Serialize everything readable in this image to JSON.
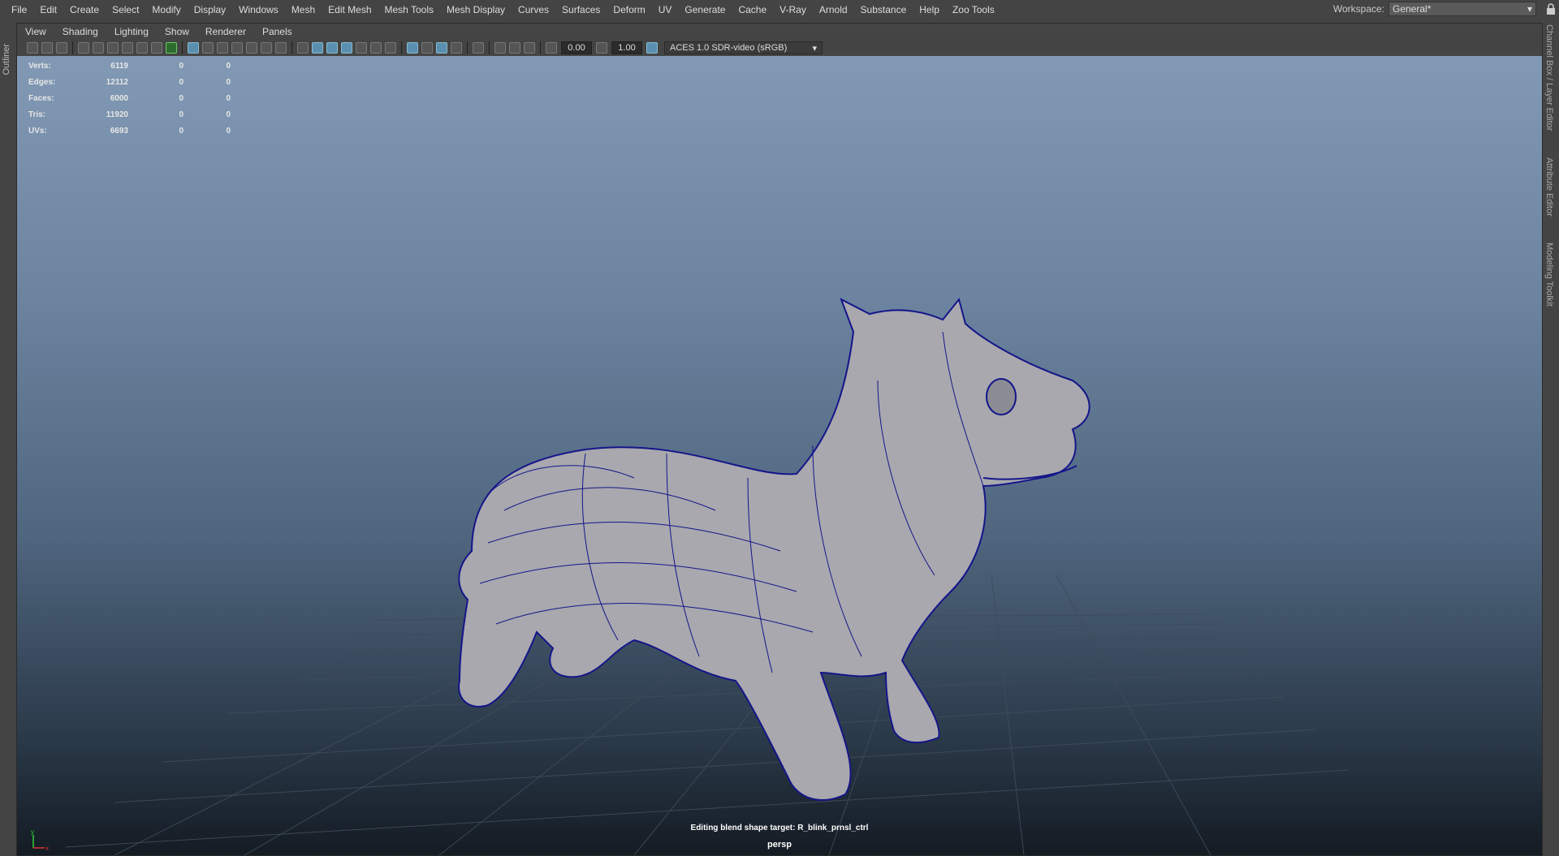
{
  "menubar": {
    "items": [
      "File",
      "Edit",
      "Create",
      "Select",
      "Modify",
      "Display",
      "Windows",
      "Mesh",
      "Edit Mesh",
      "Mesh Tools",
      "Mesh Display",
      "Curves",
      "Surfaces",
      "Deform",
      "UV",
      "Generate",
      "Cache",
      "V-Ray",
      "Arnold",
      "Substance",
      "Help",
      "Zoo Tools"
    ],
    "workspace_label": "Workspace:",
    "workspace_value": "General*"
  },
  "left_tabs": {
    "outliner": "Outliner"
  },
  "right_tabs": [
    "Channel Box / Layer Editor",
    "Attribute Editor",
    "Modeling Toolkit"
  ],
  "panel": {
    "menu": [
      "View",
      "Shading",
      "Lighting",
      "Show",
      "Renderer",
      "Panels"
    ],
    "toolbar": {
      "exposure": "0.00",
      "gamma": "1.00",
      "color_space": "ACES 1.0 SDR-video (sRGB)"
    }
  },
  "hud": {
    "rows": [
      {
        "label": "Verts:",
        "a": "6119",
        "b": "0",
        "c": "0"
      },
      {
        "label": "Edges:",
        "a": "12112",
        "b": "0",
        "c": "0"
      },
      {
        "label": "Faces:",
        "a": "6000",
        "b": "0",
        "c": "0"
      },
      {
        "label": "Tris:",
        "a": "11920",
        "b": "0",
        "c": "0"
      },
      {
        "label": "UVs:",
        "a": "6693",
        "b": "0",
        "c": "0"
      }
    ]
  },
  "viewport": {
    "message": "Editing blend shape target: R_blink_prnsl_ctrl",
    "camera": "persp",
    "axis_y": "y",
    "axis_x": "x"
  }
}
